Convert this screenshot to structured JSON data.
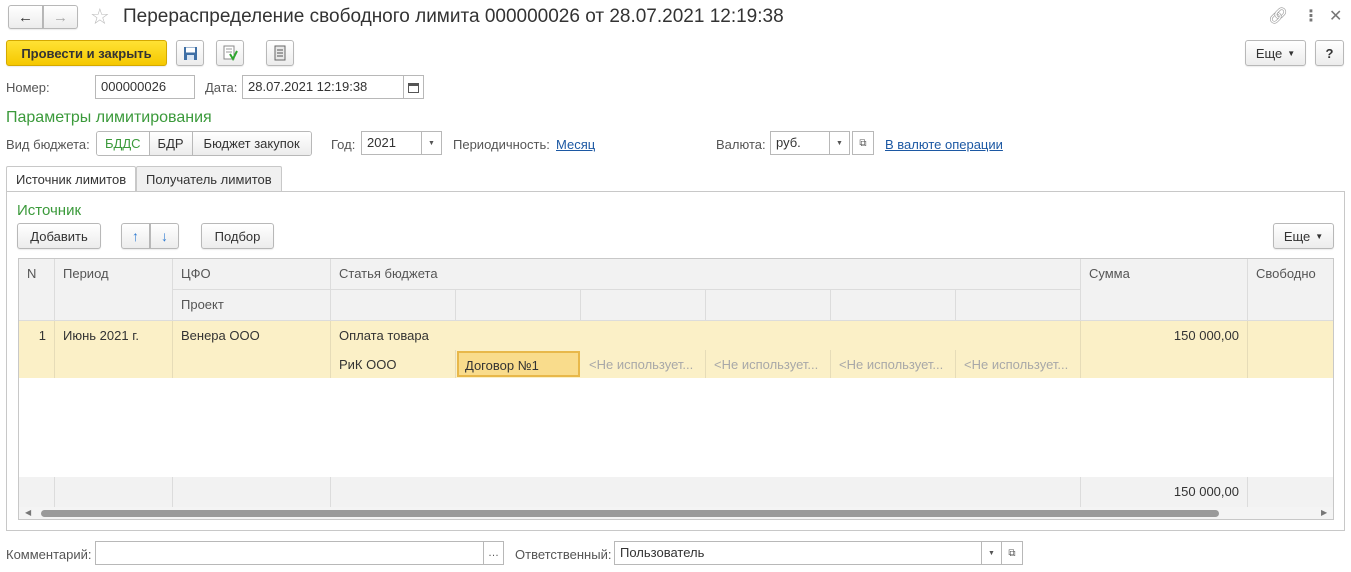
{
  "window": {
    "title": "Перераспределение свободного лимита 000000026 от 28.07.2021 12:19:38"
  },
  "toolbar": {
    "post_close_label": "Провести и закрыть",
    "more_label": "Еще",
    "help_label": "?"
  },
  "header": {
    "number_label": "Номер:",
    "number_value": "000000026",
    "date_label": "Дата:",
    "date_value": "28.07.2021 12:19:38"
  },
  "limits": {
    "section_title": "Параметры лимитирования",
    "budget_type_label": "Вид бюджета:",
    "budget_types": [
      "БДДС",
      "БДР",
      "Бюджет закупок"
    ],
    "budget_type_selected": "БДДС",
    "year_label": "Год:",
    "year_value": "2021",
    "periodicity_label": "Периодичность:",
    "periodicity_value": "Месяц",
    "currency_label": "Валюта:",
    "currency_value": "руб.",
    "currency_link": "В валюте операции"
  },
  "tabs": [
    {
      "label": "Источник лимитов",
      "active": true
    },
    {
      "label": "Получатель лимитов",
      "active": false
    }
  ],
  "source": {
    "title": "Источник",
    "add_label": "Добавить",
    "pick_label": "Подбор",
    "more_label": "Еще"
  },
  "table": {
    "headers": {
      "n": "N",
      "period": "Период",
      "cfo": "ЦФО",
      "project": "Проект",
      "article": "Статья бюджета",
      "sum": "Сумма",
      "free": "Свободно"
    },
    "rows": [
      {
        "n": "1",
        "period": "Июнь 2021 г.",
        "cfo": "Венера ООО",
        "article": "Оплата товара",
        "analytics": [
          "РиК ООО",
          "Договор №1",
          "<Не используется>",
          "<Не используется>",
          "<Не используется>",
          "<Не используется>"
        ],
        "analytics_display": [
          "РиК ООО",
          "Договор №1",
          "<Не использует...",
          "<Не использует...",
          "<Не использует...",
          "<Не использует..."
        ],
        "sum": "150 000,00"
      }
    ],
    "total_sum": "150 000,00"
  },
  "footer": {
    "comment_label": "Комментарий:",
    "comment_value": "",
    "responsible_label": "Ответственный:",
    "responsible_value": "Пользователь"
  },
  "colors": {
    "accent_green": "#3b9a3b",
    "primary_yellow": "#f5c800",
    "selected_row": "#fbf0c7",
    "link_blue": "#1c58a3"
  }
}
